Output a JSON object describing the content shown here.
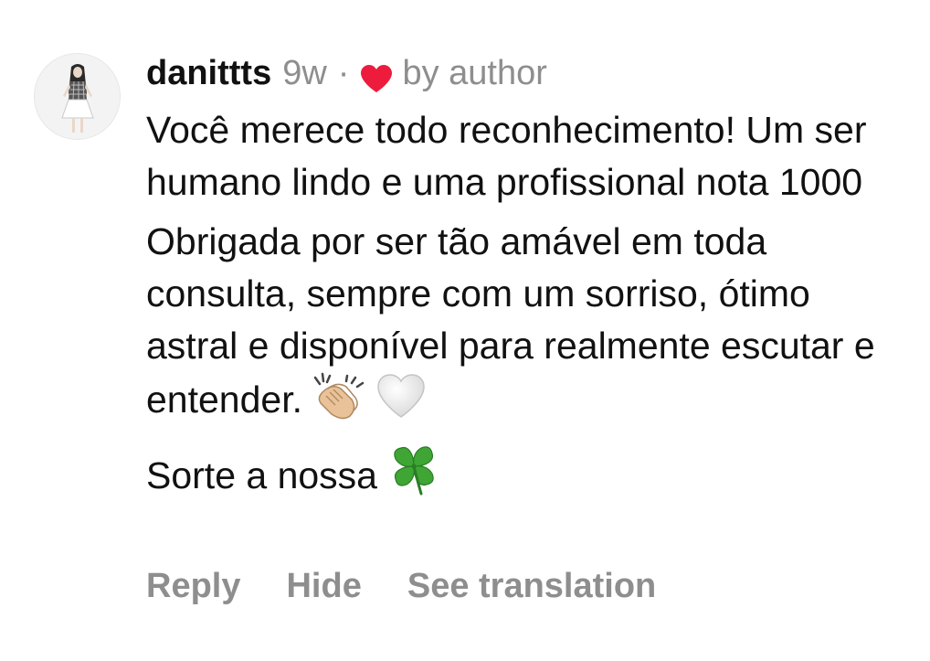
{
  "comment": {
    "username": "danittts",
    "time": "9w",
    "separator": "·",
    "liked_by": "by author",
    "paragraphs": [
      "Você merece todo reconhecimento! Um ser humano lindo e uma profissional nota 1000",
      "Obrigada por ser tão amável em toda consulta, sempre com um sorriso, ótimo astral e disponível para realmente escutar e entender.",
      "Sorte a nossa"
    ],
    "icons": {
      "avatar": "user-avatar",
      "liked": "heart-icon",
      "emoji_p2": [
        "clapping-hands-emoji",
        "white-heart-emoji"
      ],
      "emoji_p3": [
        "four-leaf-clover-emoji"
      ]
    },
    "colors": {
      "heart": "#ed1c3c",
      "secondary_text": "#8e8e8e",
      "primary_text": "#111111"
    }
  },
  "actions": {
    "reply": "Reply",
    "hide": "Hide",
    "see_translation": "See translation"
  }
}
